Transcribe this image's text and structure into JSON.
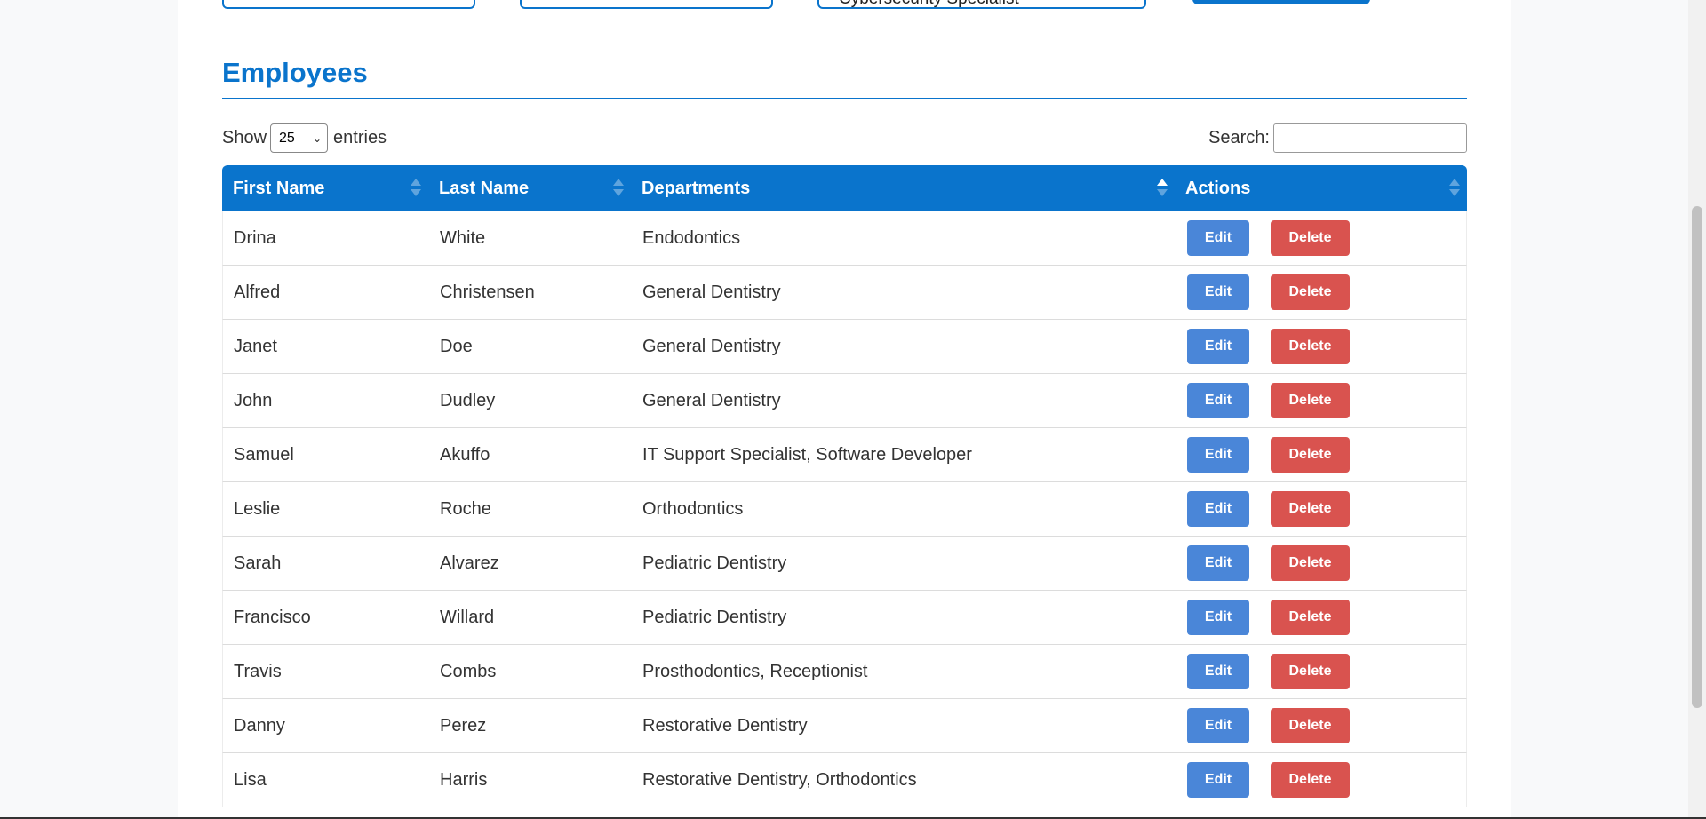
{
  "form": {
    "role_select_value": "Cybersecurity Specialist"
  },
  "employees_section": {
    "title": "Employees",
    "length": {
      "show_label": "Show",
      "selected": "25",
      "entries_label": "entries"
    },
    "search": {
      "label": "Search:",
      "value": ""
    },
    "columns": [
      "First Name",
      "Last Name",
      "Departments",
      "Actions"
    ],
    "sorted_column": "Departments",
    "sort_direction": "ascending",
    "rows": [
      {
        "first": "Drina",
        "last": "White",
        "dept": "Endodontics"
      },
      {
        "first": "Alfred",
        "last": "Christensen",
        "dept": "General Dentistry"
      },
      {
        "first": "Janet",
        "last": "Doe",
        "dept": "General Dentistry"
      },
      {
        "first": "John",
        "last": "Dudley",
        "dept": "General Dentistry"
      },
      {
        "first": "Samuel",
        "last": "Akuffo",
        "dept": "IT Support Specialist, Software Developer"
      },
      {
        "first": "Leslie",
        "last": "Roche",
        "dept": "Orthodontics"
      },
      {
        "first": "Sarah",
        "last": "Alvarez",
        "dept": "Pediatric Dentistry"
      },
      {
        "first": "Francisco",
        "last": "Willard",
        "dept": "Pediatric Dentistry"
      },
      {
        "first": "Travis",
        "last": "Combs",
        "dept": "Prosthodontics, Receptionist"
      },
      {
        "first": "Danny",
        "last": "Perez",
        "dept": "Restorative Dentistry"
      },
      {
        "first": "Lisa",
        "last": "Harris",
        "dept": "Restorative Dentistry, Orthodontics"
      }
    ],
    "edit_label": "Edit",
    "delete_label": "Delete"
  },
  "colors": {
    "primary": "#0a74cc",
    "edit_button": "#4a86d8",
    "delete_button": "#d9534f"
  }
}
